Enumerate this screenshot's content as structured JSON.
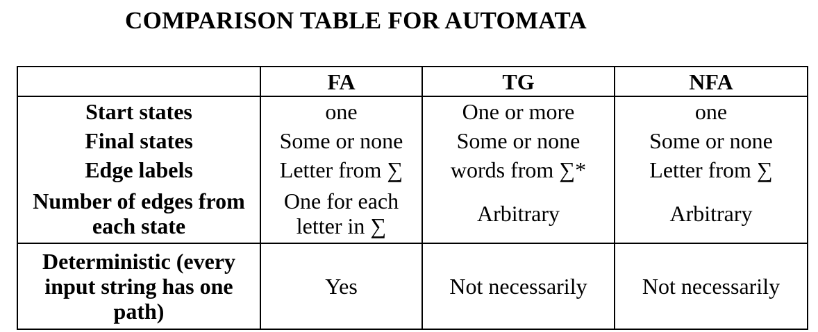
{
  "title": "COMPARISON TABLE FOR AUTOMATA",
  "table": {
    "columns": [
      "",
      "FA",
      "TG",
      "NFA"
    ],
    "rows": [
      {
        "label": "Start states",
        "values": [
          "one",
          "One or more",
          "one"
        ]
      },
      {
        "label": "Final states",
        "values": [
          "Some or none",
          "Some or none",
          "Some or none"
        ]
      },
      {
        "label": "Edge labels",
        "values": [
          "Letter from ∑",
          "words from ∑*",
          "Letter from ∑"
        ]
      },
      {
        "label": "Number of edges from each state",
        "values": [
          "One for each letter in ∑",
          "Arbitrary",
          "Arbitrary"
        ]
      },
      {
        "label": "Deterministic (every input string has one path)",
        "values": [
          "Yes",
          "Not necessarily",
          "Not necessarily"
        ]
      }
    ]
  }
}
